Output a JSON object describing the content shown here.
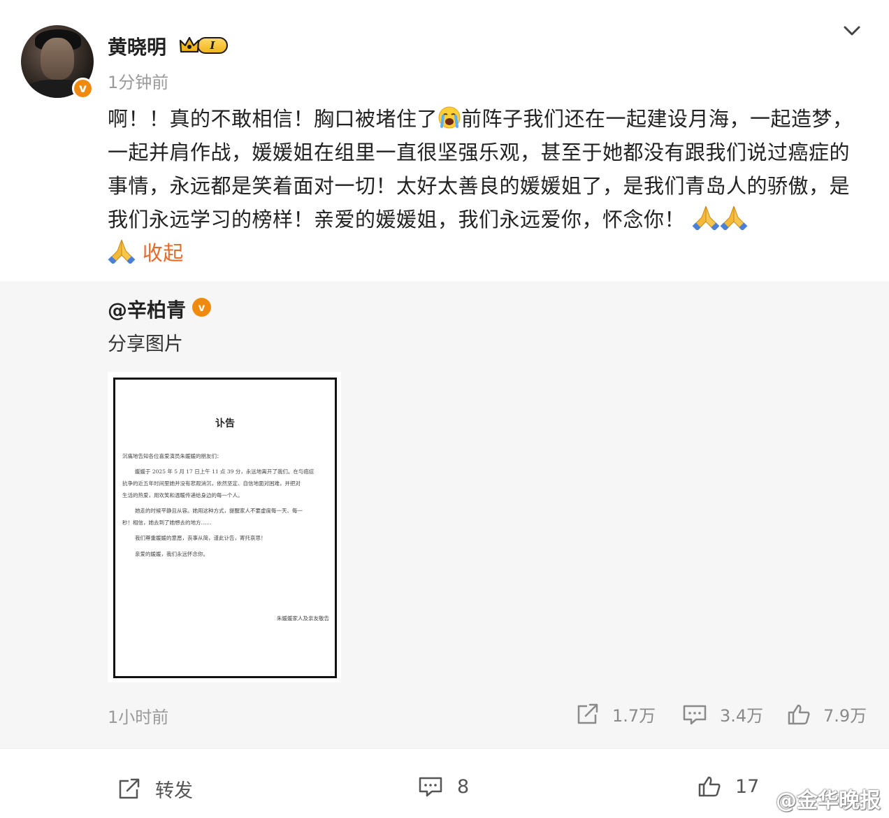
{
  "post": {
    "username": "黄晓明",
    "badge_text": "I",
    "timestamp": "1分钟前",
    "text": "啊！！真的不敢相信！胸口被堵住了",
    "text_after_emoji": "前阵子我们还在一起建设月海，一起造梦，一起并肩作战，媛媛姐在组里一直很坚强乐观，甚至于她都没有跟我们说过癌症的事情，永远都是笑着面对一切！太好太善良的媛媛姐了，是我们青岛人的骄傲，是我们永远学习的榜样！亲爱的媛媛姐，我们永远爱你，怀念你！",
    "collapse_label": "收起",
    "verified_mark": "v"
  },
  "repost": {
    "username": "@辛柏青",
    "verified_mark": "v",
    "text": "分享图片",
    "time": "1小时前",
    "stats": {
      "reposts": "1.7万",
      "comments": "3.4万",
      "likes": "7.9万"
    },
    "document": {
      "title": "讣告",
      "salutation": "沉痛地告知各位喜爱演员朱媛媛的朋友们：",
      "para1_l1": "媛媛于 2025 年 5 月 17 日上午 11 点 39 分，永远地离开了我们。在与癌症",
      "para1_l2": "抗争的近五年时间里她并没有悲观消沉，依然坚定、自信地面对困难，并把对",
      "para1_l3": "生活的热爱，用欢笑和温暖传递给身边的每一个人。",
      "para2_l1": "她走的时候平静且从容。她用这种方式，提醒家人不要虚度每一天、每一",
      "para2_l2": "秒！相信，她去到了她想去的地方……",
      "para3": "我们尊重媛媛的意愿，丧事从简，谨此讣告，寄托哀思！",
      "para4": "亲爱的媛媛，我们永远怀念你。",
      "signature": "朱媛媛家人及亲友敬告"
    }
  },
  "toolbar": {
    "repost_label": "转发",
    "comment_count": "8",
    "like_count": "17"
  },
  "watermark": "@金华晚报",
  "colors": {
    "accent_orange": "#e86a2b",
    "verified_orange": "#f08a0c",
    "muted_gray": "#9a9a9a"
  }
}
